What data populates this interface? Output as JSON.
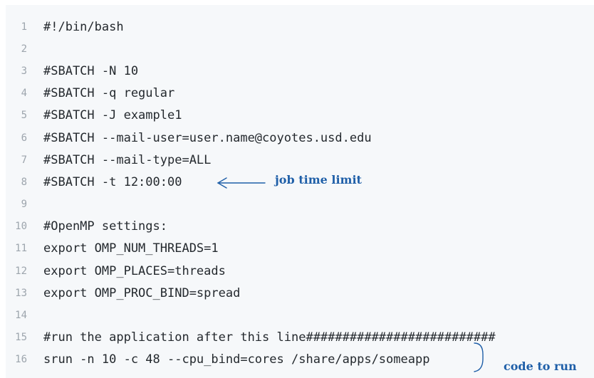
{
  "code": {
    "lines": [
      {
        "num": "1",
        "text": "#!/bin/bash"
      },
      {
        "num": "2",
        "text": ""
      },
      {
        "num": "3",
        "text": "#SBATCH -N 10"
      },
      {
        "num": "4",
        "text": "#SBATCH -q regular"
      },
      {
        "num": "5",
        "text": "#SBATCH -J example1"
      },
      {
        "num": "6",
        "text": "#SBATCH --mail-user=user.name@coyotes.usd.edu"
      },
      {
        "num": "7",
        "text": "#SBATCH --mail-type=ALL"
      },
      {
        "num": "8",
        "text": "#SBATCH -t 12:00:00"
      },
      {
        "num": "9",
        "text": ""
      },
      {
        "num": "10",
        "text": "#OpenMP settings:"
      },
      {
        "num": "11",
        "text": "export OMP_NUM_THREADS=1"
      },
      {
        "num": "12",
        "text": "export OMP_PLACES=threads"
      },
      {
        "num": "13",
        "text": "export OMP_PROC_BIND=spread"
      },
      {
        "num": "14",
        "text": ""
      },
      {
        "num": "15",
        "text": "#run the application after this line##########################"
      },
      {
        "num": "16",
        "text": "srun -n 10 -c 48 --cpu_bind=cores /share/apps/someapp"
      }
    ]
  },
  "annotations": {
    "time_limit_label": "job time limit",
    "code_to_run_label": "code to run",
    "color": "#1f5fa8"
  },
  "colors": {
    "panel_background": "#f6f8fa",
    "line_number": "#9da5ad",
    "code_text": "#24292e"
  }
}
